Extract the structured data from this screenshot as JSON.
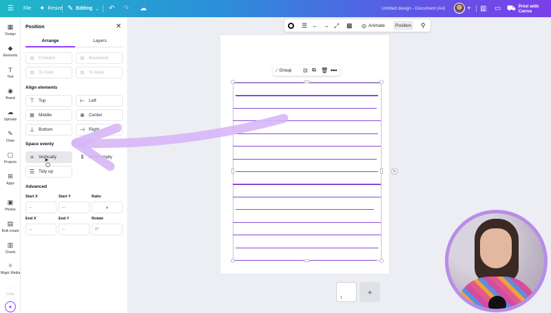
{
  "topbar": {
    "file": "File",
    "resize": "Resize",
    "editing": "Editing",
    "doc_title": "Untitled design - Document (A4)",
    "print": "Print with Canva"
  },
  "rail": {
    "items": [
      "Design",
      "Elements",
      "Text",
      "Brand",
      "Uploads",
      "Draw",
      "Projects",
      "Apps",
      "Photos",
      "Bulk create",
      "Charts",
      "Magic Media",
      "Code"
    ]
  },
  "panel": {
    "title": "Position",
    "tabs": [
      "Arrange",
      "Layers"
    ],
    "arrange": [
      "Forward",
      "Backward",
      "To front",
      "To back"
    ],
    "align_title": "Align elements",
    "align": [
      "Top",
      "Left",
      "Middle",
      "Center",
      "Bottom",
      "Right"
    ],
    "space_title": "Space evenly",
    "space": [
      "Vertically",
      "Horizontally",
      "Tidy up"
    ],
    "advanced_title": "Advanced",
    "fields": {
      "start_x": {
        "label": "Start X",
        "value": "--"
      },
      "start_y": {
        "label": "Start Y",
        "value": "--"
      },
      "ratio": {
        "label": "Ratio"
      },
      "end_x": {
        "label": "End X",
        "value": "--"
      },
      "end_y": {
        "label": "End Y",
        "value": "--"
      },
      "rotate": {
        "label": "Rotate",
        "value": "0°"
      }
    }
  },
  "context_toolbar": {
    "animate": "Animate",
    "position": "Position"
  },
  "group_bar": {
    "group": "Group"
  },
  "pages": {
    "current": "1"
  },
  "colors": {
    "accent": "#8b3dff",
    "line": "#8747d6"
  }
}
